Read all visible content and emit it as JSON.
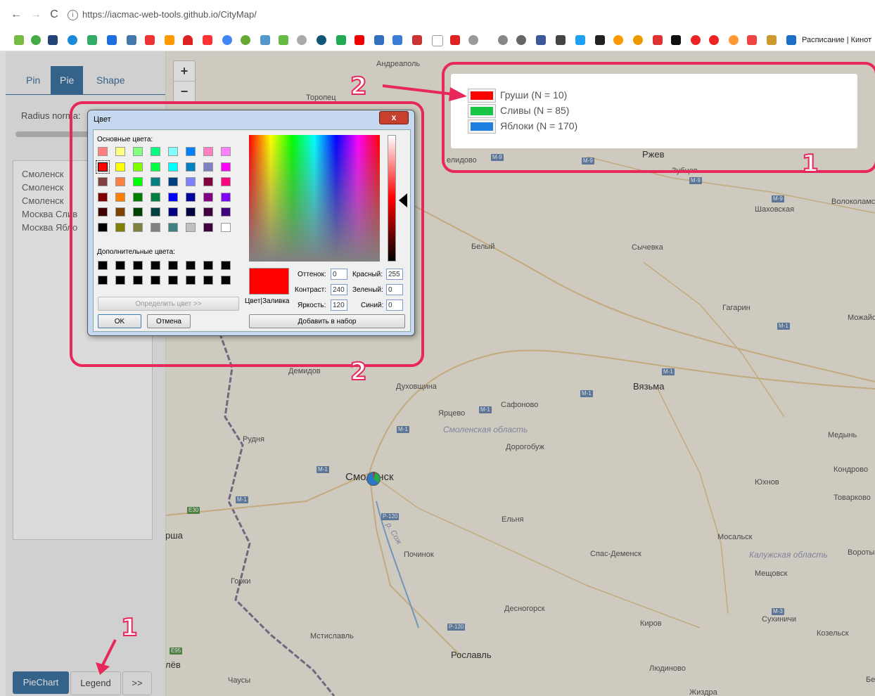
{
  "browser": {
    "url": "https://iacmac-web-tools.github.io/CityMap/",
    "bookmarks_text": "Расписание | Кинот"
  },
  "sidebar": {
    "tabs": [
      {
        "label": "Pin"
      },
      {
        "label": "Pie"
      },
      {
        "label": "Shape"
      }
    ],
    "radius_label": "Radius norma:",
    "list_items": [
      "Смоленск",
      "Смоленск",
      "Смоленск",
      "Москва  Слив",
      "Москва  Ябло"
    ],
    "buttons": {
      "piechart": "PieChart",
      "legend": "Legend",
      "more": ">>"
    }
  },
  "map": {
    "zoom_in": "+",
    "zoom_out": "−",
    "cities": [
      {
        "name": "Андреаполь"
      },
      {
        "name": "Торопец"
      },
      {
        "name": "Ржев"
      },
      {
        "name": "Зубцов"
      },
      {
        "name": "Шаховская"
      },
      {
        "name": "Волоколамс"
      },
      {
        "name": "Белый"
      },
      {
        "name": "Сычевка"
      },
      {
        "name": "Гагарин"
      },
      {
        "name": "Можайс"
      },
      {
        "name": "Демидов"
      },
      {
        "name": "Духовщина"
      },
      {
        "name": "Вязьма"
      },
      {
        "name": "Ярцево"
      },
      {
        "name": "Сафоново"
      },
      {
        "name": "Смоленская область"
      },
      {
        "name": "Медынь"
      },
      {
        "name": "Рудня"
      },
      {
        "name": "Дорогобуж"
      },
      {
        "name": "Кондрово"
      },
      {
        "name": "Смоленск"
      },
      {
        "name": "Юхнов"
      },
      {
        "name": "Товарково"
      },
      {
        "name": "Ельня"
      },
      {
        "name": "р. Сож"
      },
      {
        "name": "рша"
      },
      {
        "name": "Мосальск"
      },
      {
        "name": "Починок"
      },
      {
        "name": "Спас-Деменск"
      },
      {
        "name": "Калужская область"
      },
      {
        "name": "Вороты"
      },
      {
        "name": "Мещовск"
      },
      {
        "name": "Горки"
      },
      {
        "name": "Десногорск"
      },
      {
        "name": "Сухиничи"
      },
      {
        "name": "Киров"
      },
      {
        "name": "Козельск"
      },
      {
        "name": "Мстиславль"
      },
      {
        "name": "Рославль"
      },
      {
        "name": "лёв"
      },
      {
        "name": "Людиново"
      },
      {
        "name": "Чаусы"
      },
      {
        "name": "Жиздра"
      },
      {
        "name": "Бе"
      },
      {
        "name": "елидово"
      }
    ],
    "roads": [
      "M-9",
      "M-9",
      "M-9",
      "M-9",
      "M-1",
      "M-1",
      "M-1",
      "M-1",
      "M-1",
      "M-1",
      "M-1",
      "P-120",
      "P-120",
      "M-3",
      "E30",
      "E95"
    ]
  },
  "legend": {
    "items": [
      {
        "label": "Груши (N = 10)",
        "color": "#ff0000"
      },
      {
        "label": "Сливы (N = 85)",
        "color": "#18c545"
      },
      {
        "label": "Яблоки (N = 170)",
        "color": "#1e7fe0"
      }
    ]
  },
  "color_dialog": {
    "title": "Цвет",
    "close": "x",
    "basic_colors_label": "Основные цвета:",
    "custom_colors_label": "Дополнительные цвета:",
    "define_button": "Определить цвет >>",
    "ok": "OK",
    "cancel": "Отмена",
    "add_button": "Добавить в набор",
    "preview_label": "Цвет|Заливка",
    "fields": {
      "hue_label": "Оттенок:",
      "hue": "0",
      "sat_label": "Контраст:",
      "sat": "240",
      "lum_label": "Яркость:",
      "lum": "120",
      "red_label": "Красный:",
      "red": "255",
      "green_label": "Зеленый:",
      "green": "0",
      "blue_label": "Синий:",
      "blue": "0"
    },
    "basic_colors": [
      [
        "#ff8080",
        "#ffff80",
        "#80ff80",
        "#00ff80",
        "#80ffff",
        "#0080ff",
        "#ff80c0",
        "#ff80ff"
      ],
      [
        "#ff0000",
        "#ffff00",
        "#80ff00",
        "#00ff40",
        "#00ffff",
        "#0080c0",
        "#8080c0",
        "#ff00ff"
      ],
      [
        "#804040",
        "#ff8040",
        "#00ff00",
        "#008080",
        "#004080",
        "#8080ff",
        "#800040",
        "#ff0080"
      ],
      [
        "#800000",
        "#ff8000",
        "#008000",
        "#008040",
        "#0000ff",
        "#0000a0",
        "#800080",
        "#8000ff"
      ],
      [
        "#400000",
        "#804000",
        "#004000",
        "#004040",
        "#000080",
        "#000040",
        "#400040",
        "#400080"
      ],
      [
        "#000000",
        "#808000",
        "#808040",
        "#808080",
        "#408080",
        "#c0c0c0",
        "#400040",
        "#ffffff"
      ]
    ]
  },
  "annotations": [
    "1",
    "2",
    "2",
    "1"
  ]
}
